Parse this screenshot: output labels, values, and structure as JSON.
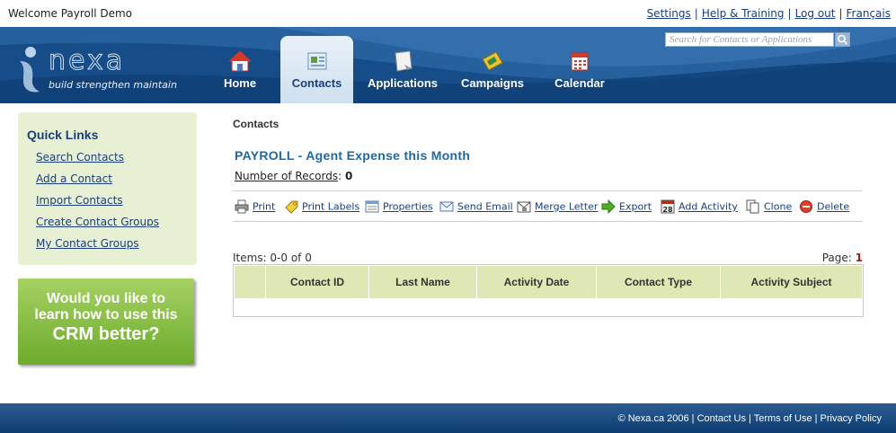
{
  "topbar": {
    "welcome": "Welcome Payroll Demo",
    "links": [
      "Settings",
      "Help & Training",
      "Log out",
      "Français"
    ]
  },
  "header": {
    "logo_text": "nexa",
    "tagline": "build strengthen maintain",
    "search_placeholder": "Search for Contacts or Applications",
    "nav": [
      {
        "label": "Home",
        "icon": "home-icon",
        "active": false
      },
      {
        "label": "Contacts",
        "icon": "contacts-icon",
        "active": true
      },
      {
        "label": "Applications",
        "icon": "applications-icon",
        "active": false
      },
      {
        "label": "Campaigns",
        "icon": "campaigns-icon",
        "active": false
      },
      {
        "label": "Calendar",
        "icon": "calendar-icon",
        "active": false
      }
    ]
  },
  "quicklinks": {
    "title": "Quick Links",
    "items": [
      "Search Contacts",
      "Add a Contact",
      "Import Contacts",
      "Create Contact Groups",
      "My Contact Groups"
    ]
  },
  "promo": {
    "line1": "Would you like to",
    "line2": "learn how to use this",
    "line3": "CRM better?"
  },
  "main": {
    "breadcrumb": "Contacts",
    "title": "PAYROLL - Agent Expense this Month",
    "records_label": "Number of Records",
    "records_sep": ":",
    "records_value": "0",
    "actions": [
      {
        "label": "Print",
        "icon": "printer-icon"
      },
      {
        "label": "Print Labels",
        "icon": "tag-icon"
      },
      {
        "label": "Properties",
        "icon": "properties-icon"
      },
      {
        "label": "Send Email",
        "icon": "envelope-icon"
      },
      {
        "label": "Merge Letter",
        "icon": "merge-letter-icon"
      },
      {
        "label": "Export",
        "icon": "arrow-right-icon"
      },
      {
        "label": "Add Activity",
        "icon": "calendar-28-icon"
      },
      {
        "label": "Clone",
        "icon": "clone-icon"
      },
      {
        "label": "Delete",
        "icon": "delete-icon"
      }
    ],
    "calendar_icon_day": "28",
    "items_label": "Items: 0-0 of 0",
    "page_label": "Page:",
    "page_value": "1",
    "columns": [
      "Contact ID",
      "Last Name",
      "Activity Date",
      "Contact Type",
      "Activity Subject"
    ]
  },
  "footer": {
    "text": "© Nexa.ca 2006 | Contact Us | Terms of Use | Privacy Policy"
  },
  "colors": {
    "header_blue": "#164c88",
    "link_blue": "#1b3e78",
    "title_blue": "#1b6aa4",
    "quicklinks_bg": "#e8f0d4",
    "grid_header_bg": "#dfe8b4",
    "promo_green": "#7cb83a",
    "page_red": "#9b1c1c"
  }
}
